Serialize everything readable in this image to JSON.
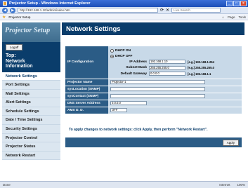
{
  "window": {
    "title": "Projector Setup - Windows Internet Explorer",
    "controls": [
      "_",
      "□",
      "×"
    ]
  },
  "address": {
    "url": "http://192.168.1.10/admin/index.htm",
    "search_placeholder": "Live Search"
  },
  "favorites": {
    "tab": "Projector Setup",
    "tools": [
      "Page",
      "Tools"
    ]
  },
  "sidebar": {
    "logo": "Projector Setup",
    "logout": "Logoff",
    "top_title_1": "Top:",
    "top_title_2": "Network",
    "top_title_3": "Information",
    "items": [
      {
        "label": "Network Settings",
        "active": true
      },
      {
        "label": "Port Settings"
      },
      {
        "label": "Mail Settings"
      },
      {
        "label": "Alert Settings"
      },
      {
        "label": "Schedule Settings"
      },
      {
        "label": "Date / Time Settings"
      },
      {
        "label": "Security Settings"
      },
      {
        "label": "Projector Control"
      },
      {
        "label": "Projector Status"
      },
      {
        "label": "Network Restart"
      }
    ]
  },
  "main": {
    "title": "Network Settings",
    "ip": {
      "label": "IP Configuration",
      "dhcp_on": "DHCP ON",
      "dhcp_off": "DHCP OFF",
      "ip_address_label": "IP Address",
      "ip_address_value": "192.168.1.10",
      "ip_hint": "[e.g.] 192.168.1.254",
      "subnet_label": "Subnet Mask",
      "subnet_value": "255.255.255.0",
      "subnet_hint": "[e.g.] 255.255.255.0",
      "gateway_label": "Default Gateway",
      "gateway_value": "0.0.0.0",
      "gateway_hint": "[e.g.] 192.168.1.1"
    },
    "projector_name": {
      "label": "Projector Name",
      "value": "Projector-1"
    },
    "location": {
      "label": "sysLocation (SNMP)",
      "value": ""
    },
    "contact": {
      "label": "sysContact (SNMP)",
      "value": ""
    },
    "dns": {
      "label": "DNS Server Address",
      "value": "0.0.0.0"
    },
    "amx": {
      "label": "AMX D. D.",
      "value": "OFF"
    },
    "note": "To apply changes to network settings: click Apply, then perform \"Network Restart\".",
    "apply": "Apply"
  },
  "status": {
    "left": "Done",
    "zone": "Internet",
    "zoom": "100%"
  }
}
